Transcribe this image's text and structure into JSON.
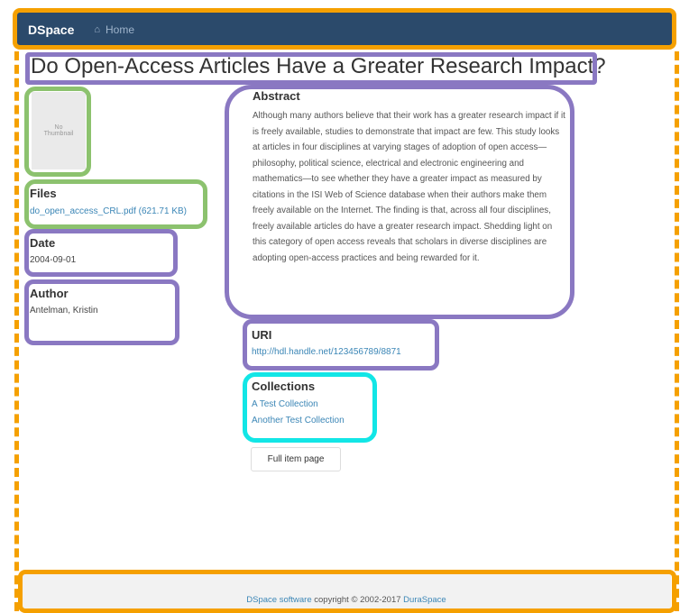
{
  "navbar": {
    "brand": "DSpace",
    "home_icon": "home-icon",
    "home_label": "Home"
  },
  "item": {
    "title": "Do Open-Access Articles Have a Greater Research Impact?",
    "thumbnail_text": "No Thumbnail",
    "files": {
      "heading": "Files",
      "file_link": "do_open_access_CRL.pdf (621.71 KB)"
    },
    "date": {
      "heading": "Date",
      "value": "2004-09-01"
    },
    "author": {
      "heading": "Author",
      "value": "Antelman, Kristin"
    },
    "abstract": {
      "heading": "Abstract",
      "text": "Although many authors believe that their work has a greater research impact if it is freely available, studies to demonstrate that impact are few. This study looks at articles in four disciplines at varying stages of adoption of open access—philosophy, political science, electrical and electronic engineering and mathematics—to see whether they have a greater impact as measured by citations in the ISI Web of Science database when their authors make them freely available on the Internet. The finding is that, across all four disciplines, freely available articles do have a greater research impact. Shedding light on this category of open access reveals that scholars in diverse disciplines are adopting open-access practices and being rewarded for it."
    },
    "uri": {
      "heading": "URI",
      "link": "http://hdl.handle.net/123456789/8871"
    },
    "collections": {
      "heading": "Collections",
      "items": [
        "A Test Collection",
        "Another Test Collection"
      ]
    },
    "full_item_button": "Full item page"
  },
  "footer": {
    "software_link": "DSpace software",
    "copyright_text": " copyright © 2002-2017 ",
    "org_link": "DuraSpace"
  },
  "colors": {
    "navbar_bg": "#2b4a6b",
    "link": "#3b86b6",
    "annotation_orange": "#f5a000",
    "annotation_purple": "#8a78c2",
    "annotation_green": "#8cc26e",
    "annotation_cyan": "#12e6e6"
  }
}
